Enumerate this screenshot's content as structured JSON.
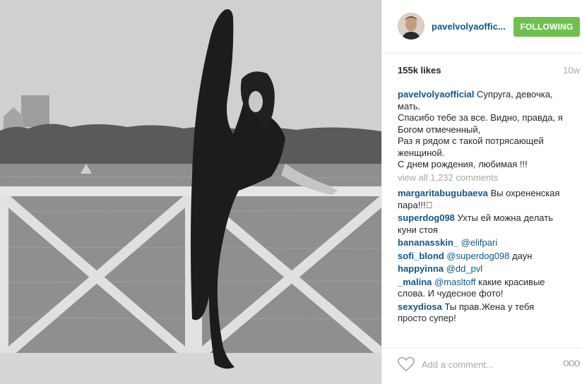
{
  "post": {
    "username": "pavelvolyaoffic...",
    "follow_label": "FOLLOWING",
    "likes": "155k likes",
    "age": "10w"
  },
  "caption": {
    "username": "pavelvolyaofficial",
    "lines": [
      "Супруга, девочка,",
      "мать.",
      "Спасибо тебе за все. Видно, правда, я",
      "Богом отмеченный,",
      "Раз я рядом с такой потрясающей",
      "женщиной.",
      "С днем рождения, любимая !!!"
    ]
  },
  "view_all": "view all 1,232 comments",
  "comments": [
    {
      "user": "margaritabugubaeva",
      "text1": "Вы охрененская",
      "text2": "пара!!!🏻"
    },
    {
      "user": "superdog098",
      "text1": "Ухты ей можна делать",
      "text2": "куни стоя"
    },
    {
      "user": "bananasskin_",
      "mention": "@elifpari",
      "text1": ""
    },
    {
      "user": "sofi_blond",
      "mention": "@superdog098",
      "text1": "даун"
    },
    {
      "user": "happyinna",
      "mention": "@dd_pvl",
      "text1": ""
    },
    {
      "user": "_malina",
      "mention": "@masltoff",
      "text1": "какие красивые",
      "text2": "слова. И чудесное фото!"
    },
    {
      "user": "sexydiosa",
      "text1": "Ты прав.Жена у тебя",
      "text2": "просто супер!"
    }
  ],
  "footer": {
    "add_comment_placeholder": "Add a comment...",
    "more_label": "ooo"
  },
  "colors": {
    "username": "#125688",
    "follow_bg": "#70c050",
    "muted": "#a5a7aa"
  }
}
